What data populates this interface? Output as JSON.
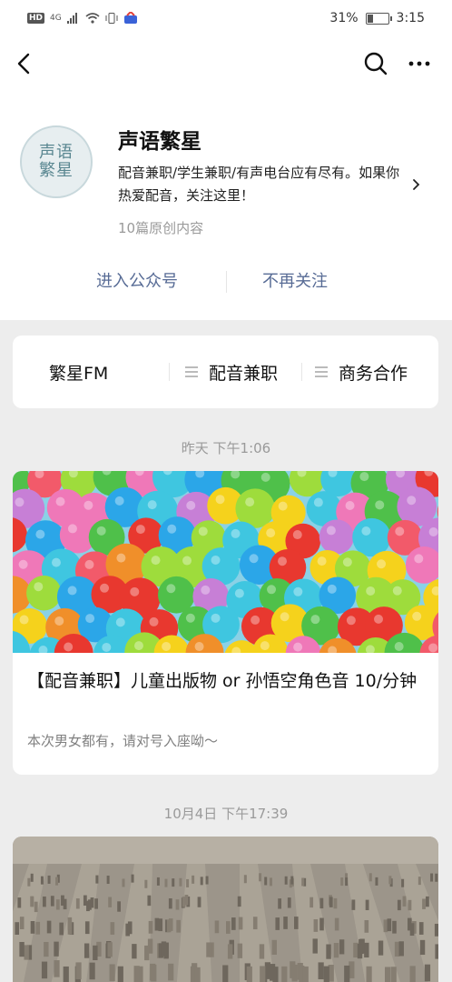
{
  "status_bar": {
    "network_badge": "HD",
    "signal_text": "4G",
    "battery_percent": "31%",
    "battery_level": 0.31,
    "time": "3:15"
  },
  "nav": {
    "back_icon": "chevron-left-icon",
    "search_icon": "search-icon",
    "more_icon": "more-horizontal-icon"
  },
  "account": {
    "avatar_text": "声语繁星",
    "name": "声语繁星",
    "description": "配音兼职/学生兼职/有声电台应有尽有。如果你热爱配音，关注这里！",
    "article_count": "10篇原创内容"
  },
  "actions": {
    "enter": "进入公众号",
    "unfollow": "不再关注"
  },
  "menu": [
    {
      "label": "繁星FM",
      "has_icon": false
    },
    {
      "label": "配音兼职",
      "has_icon": true
    },
    {
      "label": "商务合作",
      "has_icon": true
    }
  ],
  "articles": [
    {
      "date": "昨天 下午1:06",
      "title": "【配音兼职】儿童出版物 or 孙悟空角色音 10/分钟",
      "digest": "本次男女都有，请对号入座呦～",
      "cover": "colorful-ball-pit"
    },
    {
      "date": "10月4日 下午17:39",
      "cover": "terracotta-warriors"
    }
  ],
  "colors": {
    "link": "#576b95",
    "background": "#ededed",
    "muted": "#9a9a9a"
  }
}
